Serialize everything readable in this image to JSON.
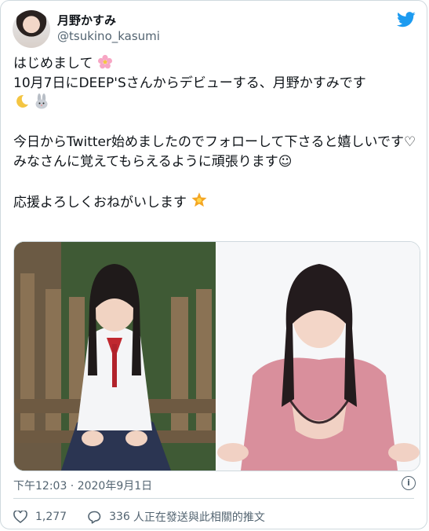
{
  "tweet": {
    "display_name": "月野かすみ",
    "handle": "@tsukino_kasumi",
    "lines": {
      "l1": "はじめまして",
      "l2": "10月7日にDEEP'Sさんからデビューする、月野かすみです",
      "l4": "今日からTwitter始めましたのでフォローして下さると嬉しいです♡",
      "l5": "みなさんに覚えてもらえるように頑張ります☺",
      "l7": "応援よろしくおねがいします"
    },
    "timestamp": "下午12:03 · 2020年9月1日",
    "likes": "1,277",
    "replies": "336",
    "reply_label": "人正在發送與此相關的推文"
  },
  "icons": [
    "twitter-bird-icon",
    "flower-icon",
    "moon-icon",
    "rabbit-icon",
    "star-icon",
    "info-icon",
    "heart-icon",
    "reply-icon"
  ],
  "colors": {
    "brand": "#1d9bf0",
    "muted": "#536471",
    "border": "#cfd9de"
  }
}
